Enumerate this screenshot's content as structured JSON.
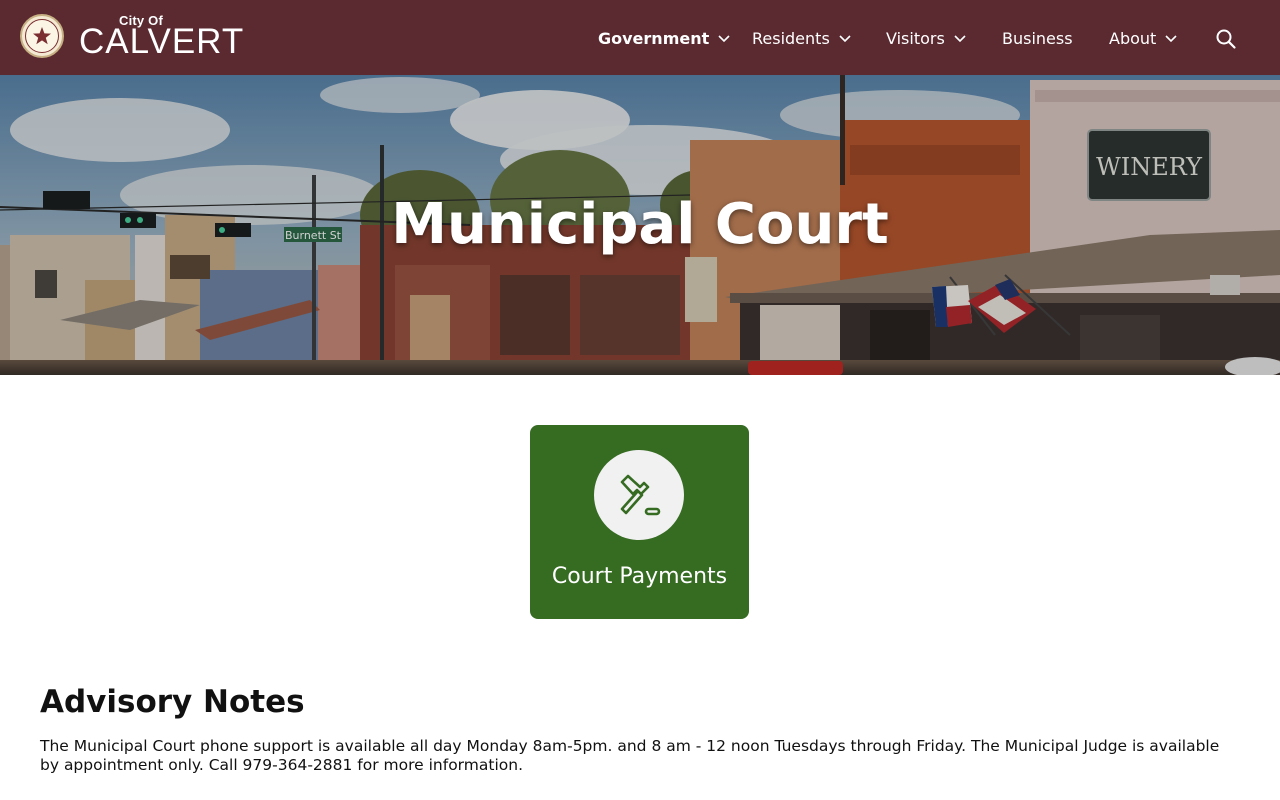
{
  "header": {
    "logo_small": "City Of",
    "logo_big": "CALVERT",
    "nav": [
      {
        "label": "Government",
        "has_dropdown": true,
        "active": true
      },
      {
        "label": "Residents",
        "has_dropdown": true,
        "active": false
      },
      {
        "label": "Visitors",
        "has_dropdown": true,
        "active": false
      },
      {
        "label": "Business",
        "has_dropdown": false,
        "active": false
      },
      {
        "label": "About",
        "has_dropdown": true,
        "active": false
      }
    ],
    "search_icon": "search-icon",
    "bg_color": "#5b2a31"
  },
  "hero": {
    "title": "Municipal Court",
    "sign_winery": "WINERY",
    "sign_street": "Burnett St"
  },
  "card": {
    "label": "Court Payments",
    "icon": "gavel-icon",
    "bg_color": "#366b22"
  },
  "advisory": {
    "title": "Advisory Notes",
    "text": "The Municipal Court phone support is available all day Monday 8am-5pm. and 8 am - 12 noon Tuesdays through Friday. The Municipal Judge is available by appointment only. Call 979-364-2881 for more information."
  }
}
